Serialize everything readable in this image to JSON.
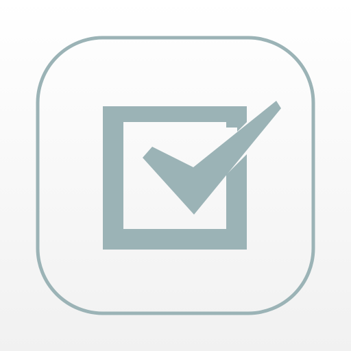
{
  "icon": {
    "name": "checkbox-checked-icon",
    "colors": {
      "background_top": "#ffffff",
      "background_bottom": "#f1f1f1",
      "accent": "#9bb3b6"
    }
  }
}
